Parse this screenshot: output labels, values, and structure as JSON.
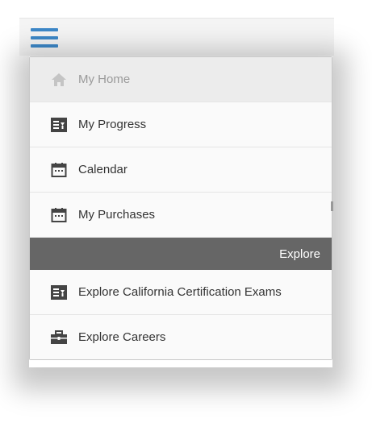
{
  "header": {
    "menu_icon": "hamburger-icon",
    "accent_color": "#3d88c8"
  },
  "menu": {
    "items": [
      {
        "label": "My Home",
        "icon": "home-icon",
        "active": true
      },
      {
        "label": "My Progress",
        "icon": "progress-board-icon"
      },
      {
        "label": "Calendar",
        "icon": "calendar-icon"
      },
      {
        "label": "My Purchases",
        "icon": "calendar-icon"
      }
    ],
    "section_label": "Explore",
    "explore_items": [
      {
        "label": "Explore California Certification Exams",
        "icon": "exam-board-icon"
      },
      {
        "label": "Explore Careers",
        "icon": "briefcase-icon"
      }
    ]
  },
  "colors": {
    "section_header_bg": "#666666",
    "active_item_bg": "#ececec"
  }
}
